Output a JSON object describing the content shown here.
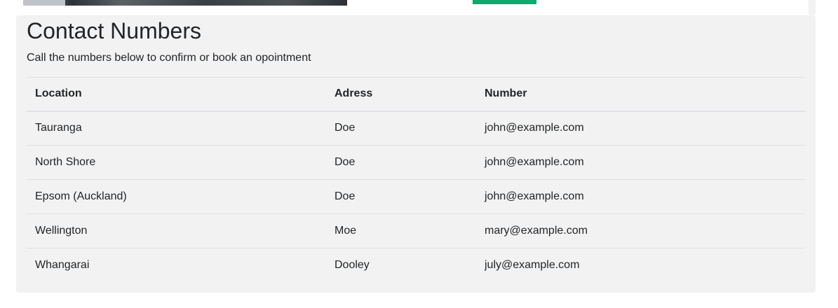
{
  "section": {
    "title": "Contact Numbers",
    "subtitle": "Call the numbers below to confirm or book an opointment"
  },
  "table": {
    "headers": [
      "Location",
      "Adress",
      "Number"
    ],
    "rows": [
      [
        "Tauranga",
        "Doe",
        "john@example.com"
      ],
      [
        "North Shore",
        "Doe",
        "john@example.com"
      ],
      [
        "Epsom (Auckland)",
        "Doe",
        "john@example.com"
      ],
      [
        "Wellington",
        "Moe",
        "mary@example.com"
      ],
      [
        "Whangarai",
        "Dooley",
        "july@example.com"
      ]
    ]
  },
  "colors": {
    "card_background": "#f2f2f2",
    "accent": "#0fa86e",
    "border": "#dee2e6",
    "text": "#212529"
  }
}
